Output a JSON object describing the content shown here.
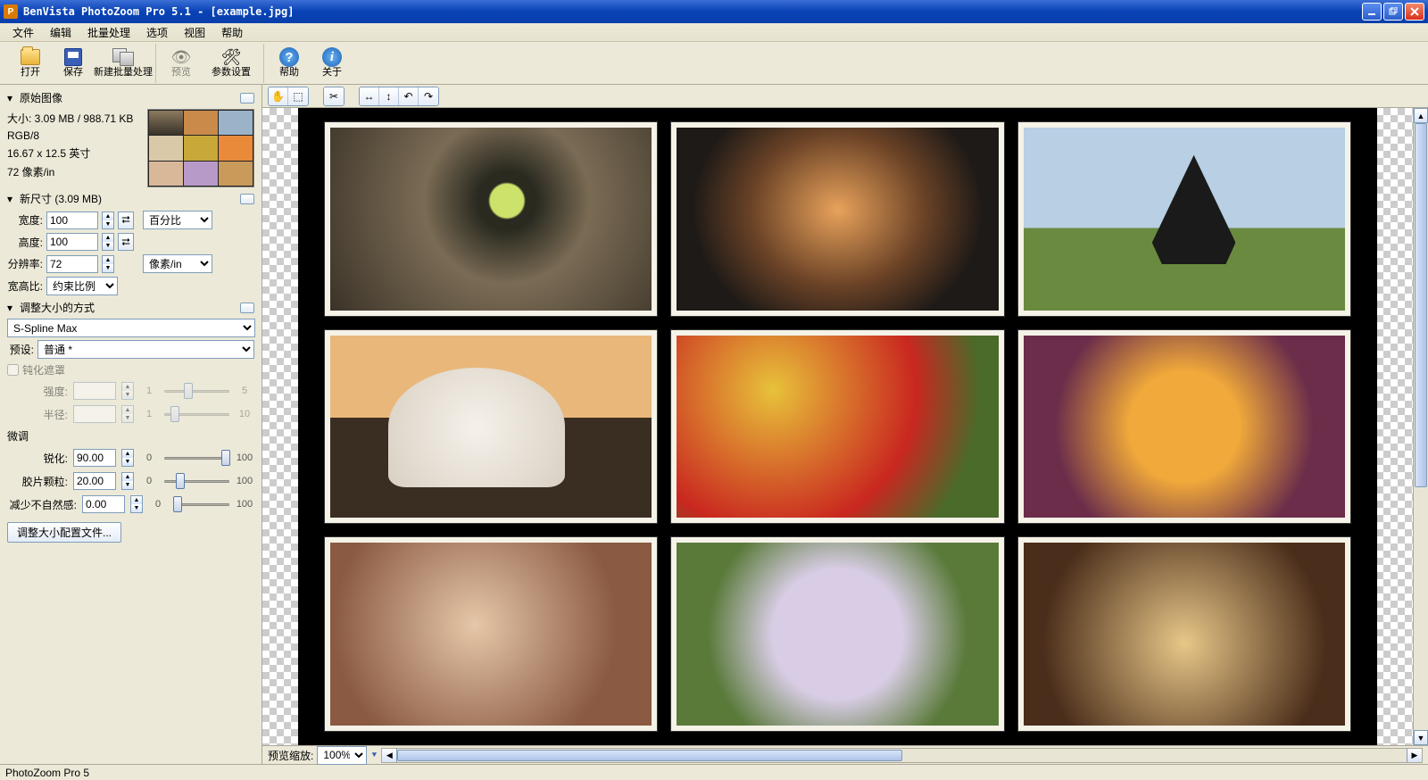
{
  "titlebar": {
    "text": "BenVista PhotoZoom Pro 5.1 - [example.jpg]"
  },
  "menu": {
    "file": "文件",
    "edit": "编辑",
    "batch": "批量处理",
    "options": "选项",
    "view": "视图",
    "help": "帮助"
  },
  "toolbar": {
    "open": "打开",
    "save": "保存",
    "newbatch": "新建批量处理",
    "preview": "预览",
    "settings": "参数设置",
    "help": "帮助",
    "about": "关于"
  },
  "orig": {
    "title": "原始图像",
    "size": "大小: 3.09 MB / 988.71 KB",
    "mode": "RGB/8",
    "dims": "16.67 x 12.5 英寸",
    "res": "72 像素/in"
  },
  "newsize": {
    "title": "新尺寸 (3.09 MB)",
    "width_label": "宽度:",
    "width": "100",
    "height_label": "高度:",
    "height": "100",
    "unit": "百分比",
    "res_label": "分辨率:",
    "res": "72",
    "res_unit": "像素/in",
    "aspect_label": "宽高比:",
    "aspect": "约束比例"
  },
  "method": {
    "title": "调整大小的方式",
    "algo": "S-Spline Max",
    "preset_label": "预设:",
    "preset": "普通 *",
    "unsharp": "钝化遮罩",
    "strength_label": "强度:",
    "strength": "",
    "radius_label": "半径:",
    "radius": "",
    "smin": "1",
    "smax5": "5",
    "smax10": "10"
  },
  "finetune": {
    "title": "微调",
    "sharp_label": "锐化:",
    "sharp": "90.00",
    "grain_label": "胶片颗粒:",
    "grain": "20.00",
    "artifact_label": "减少不自然感:",
    "artifact": "0.00",
    "min": "0",
    "max": "100",
    "config_btn": "调整大小配置文件..."
  },
  "canvas": {
    "zoom_label": "预览缩放:",
    "zoom": "100%"
  },
  "statusbar": {
    "text": "PhotoZoom Pro 5"
  }
}
